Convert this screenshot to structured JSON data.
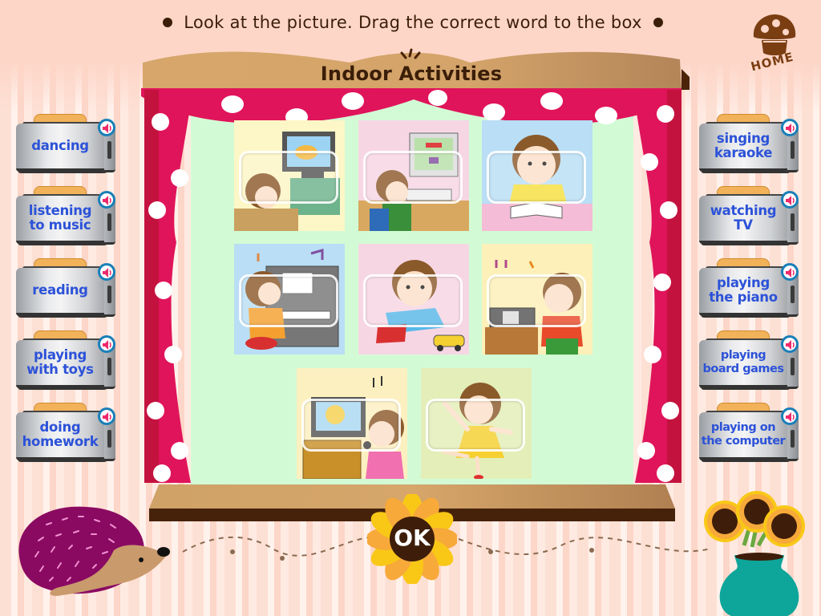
{
  "instruction": "Look at the picture. Drag the correct word to the box",
  "home": {
    "label": "HOME",
    "icon": "mushroom-home-icon"
  },
  "stage": {
    "title": "Indoor Activities"
  },
  "words_left": [
    {
      "label": "dancing"
    },
    {
      "label": "listening to music"
    },
    {
      "label": "reading"
    },
    {
      "label": "playing with toys"
    },
    {
      "label": "doing homework"
    }
  ],
  "words_right": [
    {
      "label": "singing karaoke"
    },
    {
      "label": "watching TV"
    },
    {
      "label": "playing the piano"
    },
    {
      "label": "playing board games"
    },
    {
      "label": "playing on the computer"
    }
  ],
  "pictures": [
    {
      "scene": "girl watching TV",
      "bg": "#fdf6c6"
    },
    {
      "scene": "boy playing on the computer",
      "bg": "#f7d6e4"
    },
    {
      "scene": "boy reading a book",
      "bg": "#b9def5"
    },
    {
      "scene": "girl playing the piano",
      "bg": "#b9def5"
    },
    {
      "scene": "boy playing with toy car",
      "bg": "#f7d6e4"
    },
    {
      "scene": "boy listening to music",
      "bg": "#fdf0b8"
    },
    {
      "scene": "girl singing karaoke",
      "bg": "#fdf0c0"
    },
    {
      "scene": "girl dancing",
      "bg": "#e3eeb8"
    }
  ],
  "ok_button": {
    "label": "OK"
  },
  "colors": {
    "word_text": "#2c52d8",
    "title_text": "#3b1e08",
    "curtain": "#e0145a",
    "valance": "#d4a46a",
    "stage_bg": "#d2fbd5",
    "speaker_ring": "#1a7fb8",
    "speaker_icon": "#ee2a6a"
  }
}
